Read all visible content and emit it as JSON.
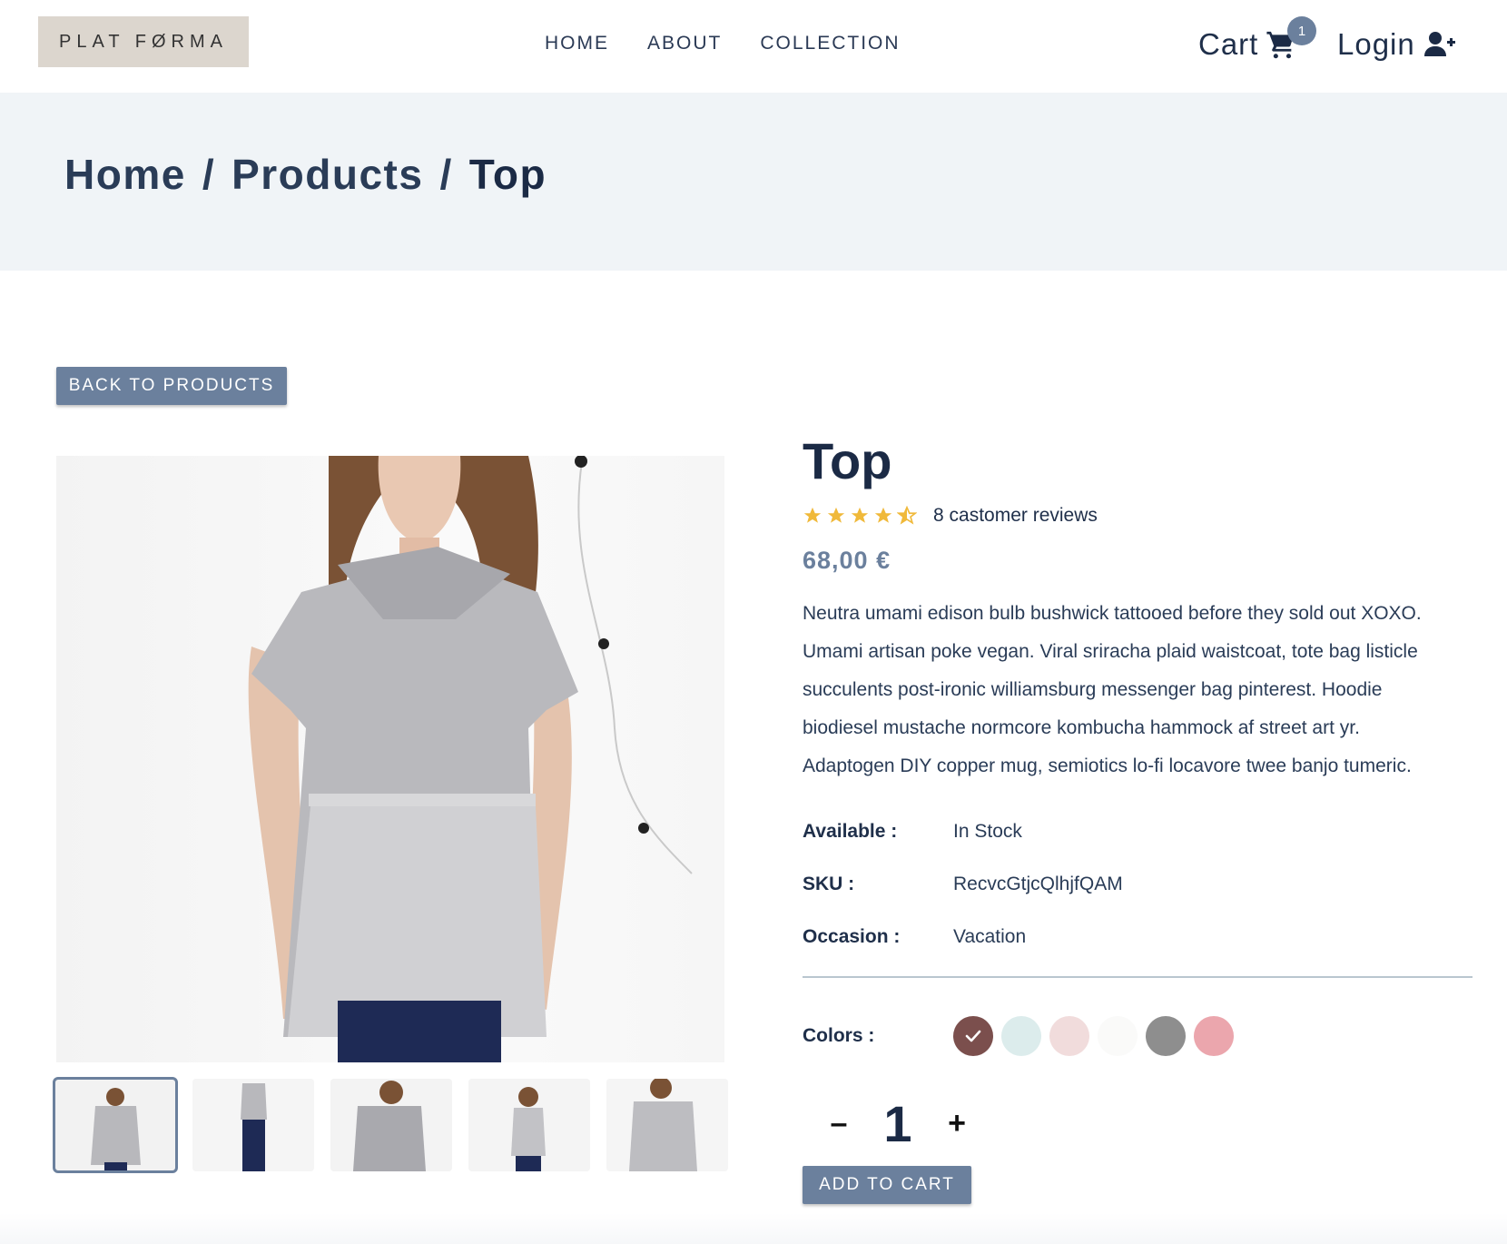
{
  "header": {
    "logo_text": "PLAT FØRMA",
    "nav": [
      "HOME",
      "ABOUT",
      "COLLECTION"
    ],
    "cart_label": "Cart",
    "cart_count": "1",
    "login_label": "Login"
  },
  "breadcrumb": {
    "home": "Home",
    "products": "Products",
    "current": "Top",
    "separator": "/"
  },
  "back_button": "BACK TO PRODUCTS",
  "product": {
    "title": "Top",
    "rating": 4.5,
    "reviews": "8 castomer reviews",
    "price": "68,00 €",
    "description": "Neutra umami edison bulb bushwick tattooed before they sold out XOXO. Umami artisan poke vegan. Viral sriracha plaid waistcoat, tote bag listicle succulents post-ironic williamsburg messenger bag pinterest. Hoodie biodiesel mustache normcore kombucha hammock af street art yr. Adaptogen DIY copper mug, semiotics lo-fi locavore twee banjo tumeric.",
    "specs": [
      {
        "label": "Available :",
        "value": "In Stock"
      },
      {
        "label": "SKU :",
        "value": "RecvcGtjcQlhjfQAM"
      },
      {
        "label": "Occasion :",
        "value": "Vacation"
      }
    ],
    "colors_label": "Colors :",
    "colors": [
      "#7b4f4d",
      "#dcecec",
      "#f1dcdc",
      "#fafaf9",
      "#8e8e8e",
      "#eba6ad"
    ],
    "selected_color": 0,
    "quantity": "1",
    "qty_minus": "–",
    "qty_plus": "+",
    "add_to_cart": "ADD TO CART"
  },
  "colors": {
    "accent": "#6b809d",
    "dark_text": "#1b2a45",
    "band": "#f0f4f7",
    "star": "#f0b93a"
  }
}
